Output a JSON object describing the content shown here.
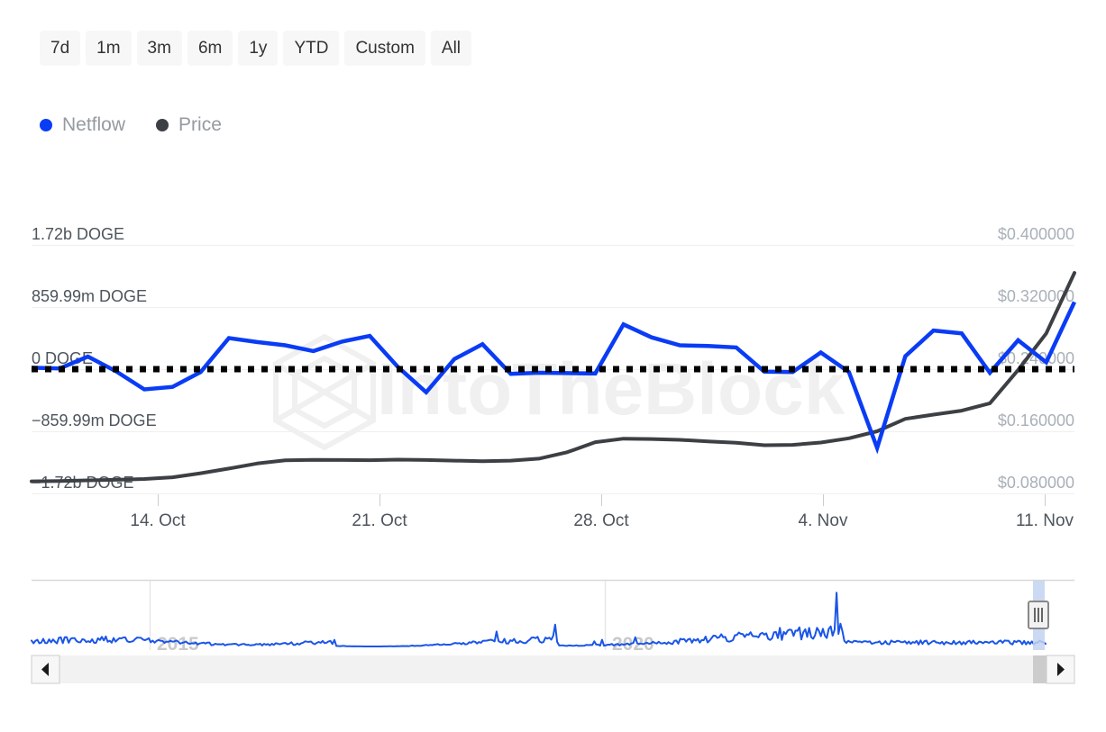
{
  "range_selector": {
    "buttons": [
      {
        "label": "7d",
        "selected": false
      },
      {
        "label": "1m",
        "selected": false
      },
      {
        "label": "3m",
        "selected": false
      },
      {
        "label": "6m",
        "selected": false
      },
      {
        "label": "1y",
        "selected": false
      },
      {
        "label": "YTD",
        "selected": false
      },
      {
        "label": "Custom",
        "selected": false
      },
      {
        "label": "All",
        "selected": false
      }
    ]
  },
  "legend": {
    "items": [
      {
        "label": "Netflow",
        "color": "#0a3cf5"
      },
      {
        "label": "Price",
        "color": "#3c4045"
      }
    ]
  },
  "watermark": {
    "text": "IntoTheBlock",
    "color": "#f0f0f0"
  },
  "navigator": {
    "year_labels": [
      "2015",
      "2020"
    ],
    "left_arrow": "◀",
    "right_arrow": "▶",
    "handle_grip": "|||"
  },
  "chart_data": {
    "type": "line",
    "title": "",
    "xlabel": "",
    "ylabel": "Netflow",
    "y2label": "Price",
    "grid": true,
    "legend_position": "top-left",
    "x_tick_labels": [
      "14. Oct",
      "21. Oct",
      "28. Oct",
      "4. Nov",
      "11. Nov"
    ],
    "y_tick_labels": [
      "1.72b DOGE",
      "859.99m DOGE",
      "0 DOGE",
      "−859.99m DOGE",
      "−1.72b DOGE"
    ],
    "y_tick_values": [
      1720000000,
      859990000,
      0,
      -859990000,
      -1720000000
    ],
    "ylim": [
      -1720000000,
      1720000000
    ],
    "y2_tick_labels": [
      "$0.400000",
      "$0.320000",
      "$0.240000",
      "$0.160000",
      "$0.080000"
    ],
    "y2_tick_values": [
      0.4,
      0.32,
      0.24,
      0.16,
      0.08
    ],
    "y2lim": [
      0.08,
      0.4
    ],
    "zero_line": {
      "value": 0,
      "style": "dotted",
      "color": "#000000"
    },
    "series": [
      {
        "name": "Netflow",
        "color": "#0a3cf5",
        "axis": "left",
        "unit": "DOGE",
        "values": [
          20000000,
          10000000,
          175000000,
          -30000000,
          -280000000,
          -245000000,
          -40000000,
          430000000,
          375000000,
          330000000,
          250000000,
          380000000,
          460000000,
          30000000,
          -320000000,
          140000000,
          345000000,
          -65000000,
          -50000000,
          -55000000,
          -60000000,
          620000000,
          440000000,
          330000000,
          320000000,
          300000000,
          -35000000,
          -40000000,
          230000000,
          -40000000,
          -1090000000,
          180000000,
          535000000,
          495000000,
          -50000000,
          400000000,
          95000000,
          930000000
        ]
      },
      {
        "name": "Price",
        "color": "#3c4045",
        "axis": "right",
        "unit": "USD",
        "values": [
          0.0955,
          0.096,
          0.0968,
          0.0975,
          0.0985,
          0.1008,
          0.106,
          0.112,
          0.1185,
          0.1225,
          0.1232,
          0.123,
          0.1228,
          0.1235,
          0.123,
          0.1222,
          0.1215,
          0.1222,
          0.1248,
          0.133,
          0.146,
          0.1505,
          0.15,
          0.149,
          0.147,
          0.1452,
          0.142,
          0.1425,
          0.1455,
          0.151,
          0.16,
          0.176,
          0.1815,
          0.1865,
          0.196,
          0.239,
          0.286,
          0.364
        ]
      }
    ],
    "navigator_series": {
      "name": "Netflow",
      "color": "#1a55e8",
      "range_selected": "far-right"
    }
  }
}
